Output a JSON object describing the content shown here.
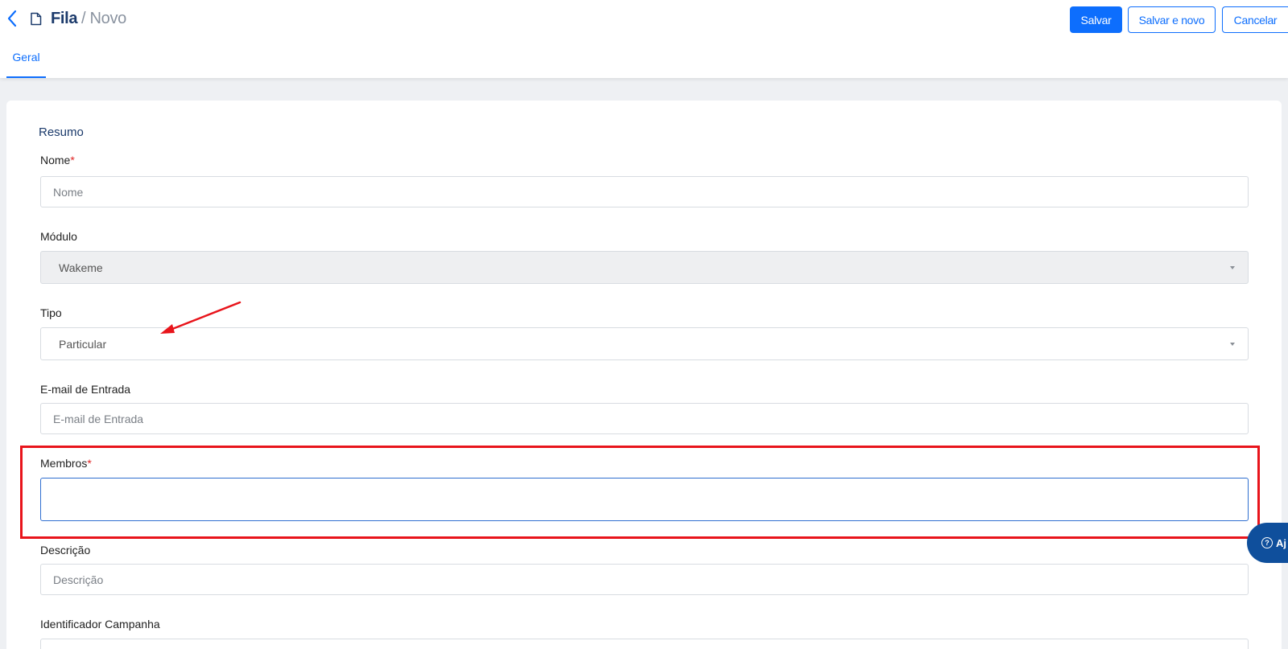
{
  "header": {
    "breadcrumb_main": "Fila",
    "breadcrumb_current": "/ Novo",
    "buttons": {
      "save": "Salvar",
      "save_new": "Salvar e novo",
      "cancel": "Cancelar"
    }
  },
  "tabs": [
    {
      "label": "Geral",
      "active": true
    }
  ],
  "form": {
    "section_title": "Resumo",
    "fields": {
      "nome": {
        "label": "Nome",
        "required_mark": "*",
        "placeholder": "Nome",
        "value": ""
      },
      "modulo": {
        "label": "Módulo",
        "value": "Wakeme",
        "disabled": true
      },
      "tipo": {
        "label": "Tipo",
        "value": "Particular"
      },
      "email": {
        "label": "E-mail de Entrada",
        "placeholder": "E-mail de Entrada",
        "value": ""
      },
      "membros": {
        "label": "Membros",
        "required_mark": "*",
        "value": ""
      },
      "descricao": {
        "label": "Descrição",
        "placeholder": "Descrição",
        "value": ""
      },
      "campanha": {
        "label": "Identificador Campanha",
        "value": ""
      }
    }
  },
  "help_button": {
    "label": "Aj"
  },
  "colors": {
    "accent": "#0d6efd",
    "title": "#1b3a6b",
    "annotation": "#e8141b",
    "help_bg": "#0f4f9c"
  },
  "icons": [
    "chevron-left-icon",
    "document-icon",
    "caret-down-icon",
    "question-circle-icon",
    "annotation-arrow"
  ]
}
